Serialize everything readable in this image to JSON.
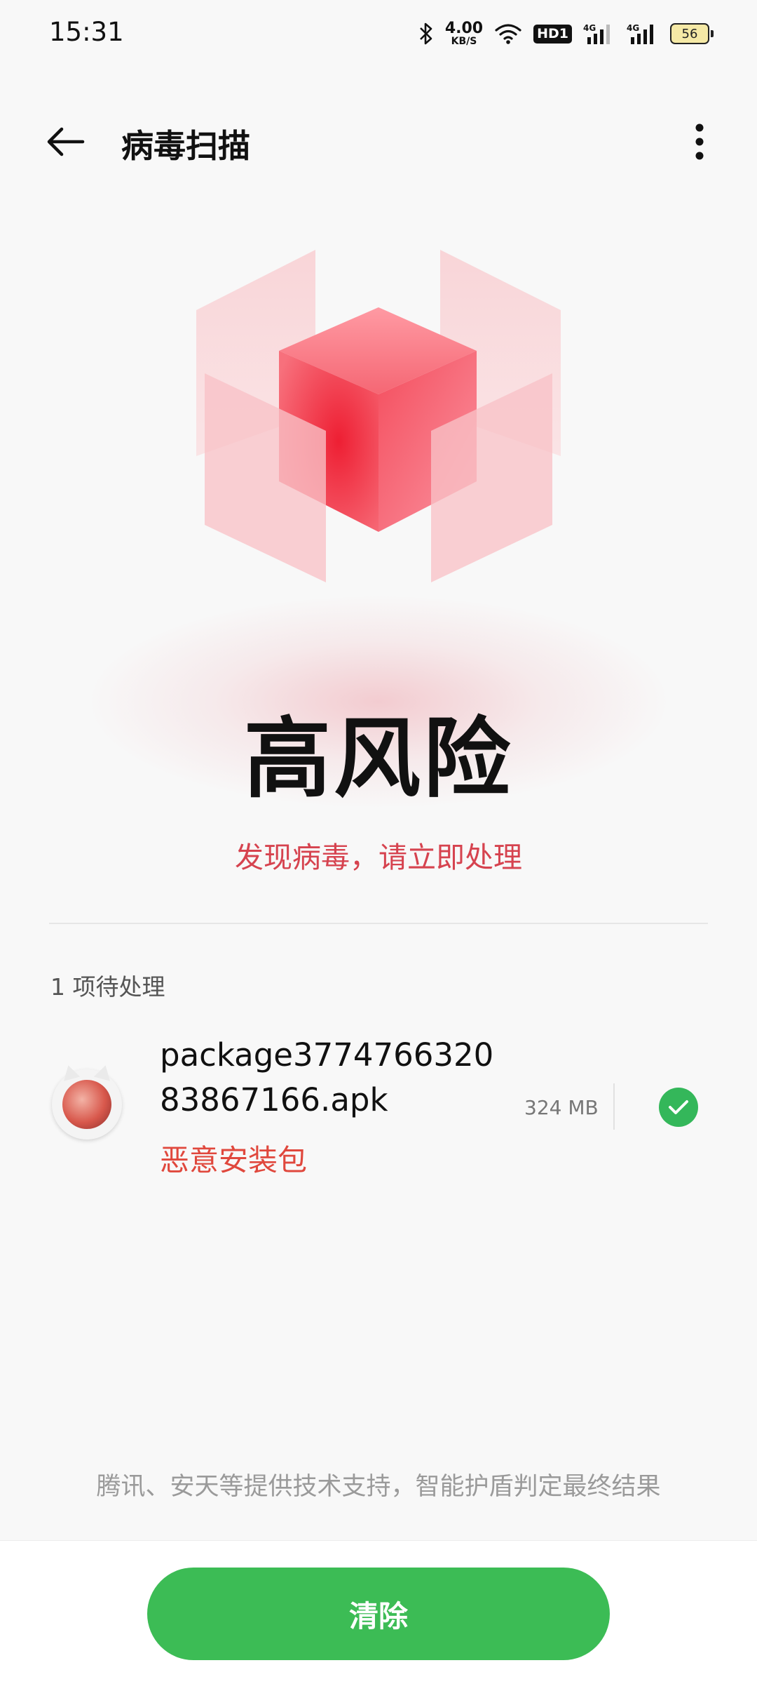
{
  "status_bar": {
    "time": "15:31",
    "net_speed_value": "4.00",
    "net_speed_unit": "KB/S",
    "hd_label": "HD1",
    "sim1_label": "4G",
    "sim2_label": "4G",
    "battery_level": "56"
  },
  "header": {
    "title": "病毒扫描"
  },
  "result": {
    "risk_level": "高风险",
    "message": "发现病毒，请立即处理"
  },
  "list": {
    "pending_count_label": "1 项待处理",
    "items": [
      {
        "file_name_line1": "package3774766320",
        "file_name_line2": "83867166.apk",
        "type_label": "恶意安装包",
        "size": "324 MB",
        "selected": true
      }
    ]
  },
  "footer": {
    "note": "腾讯、安天等提供技术支持，智能护盾判定最终结果",
    "clear_button": "清除"
  },
  "colors": {
    "danger": "#d6434f",
    "accent_green": "#3cbc55",
    "cube_red": "#f0283c"
  }
}
